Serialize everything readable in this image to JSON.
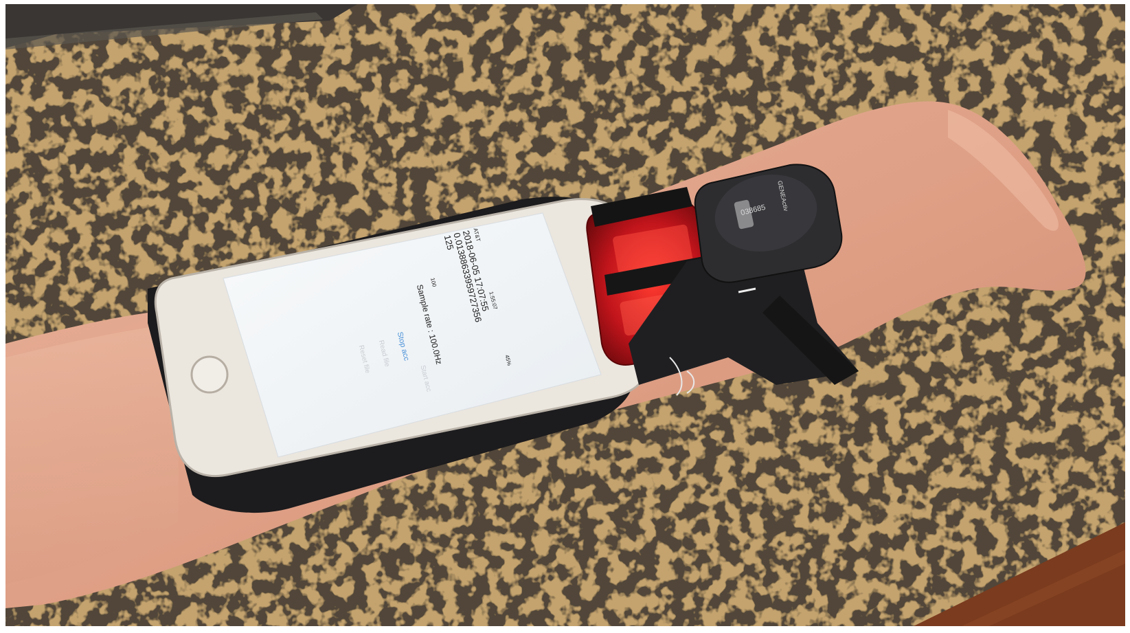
{
  "phone_screen": {
    "carrier": "AT&T",
    "time": "1:55:07",
    "battery": "45%",
    "timestamp": "2018-06-05 17:07:55",
    "reading": "0.01388633959727356",
    "count": "125",
    "input_value": "100",
    "sample_rate": "Sample rate : 100.0Hz",
    "stop_button": "Stop acc",
    "faint_button_1": "Start acc",
    "faint_button_2": "Read file",
    "faint_button_3": "Reset file"
  },
  "wrist_device": {
    "serial": "038685",
    "brand": "GENEActiv"
  },
  "colors": {
    "granite_base": "#c9a46a",
    "screen_white": "#f4f6f8",
    "phone_frame": "#e7e3dc",
    "red_clip": "#c4161c",
    "skin": "#e2a58c",
    "link_blue": "#4a90d9"
  }
}
